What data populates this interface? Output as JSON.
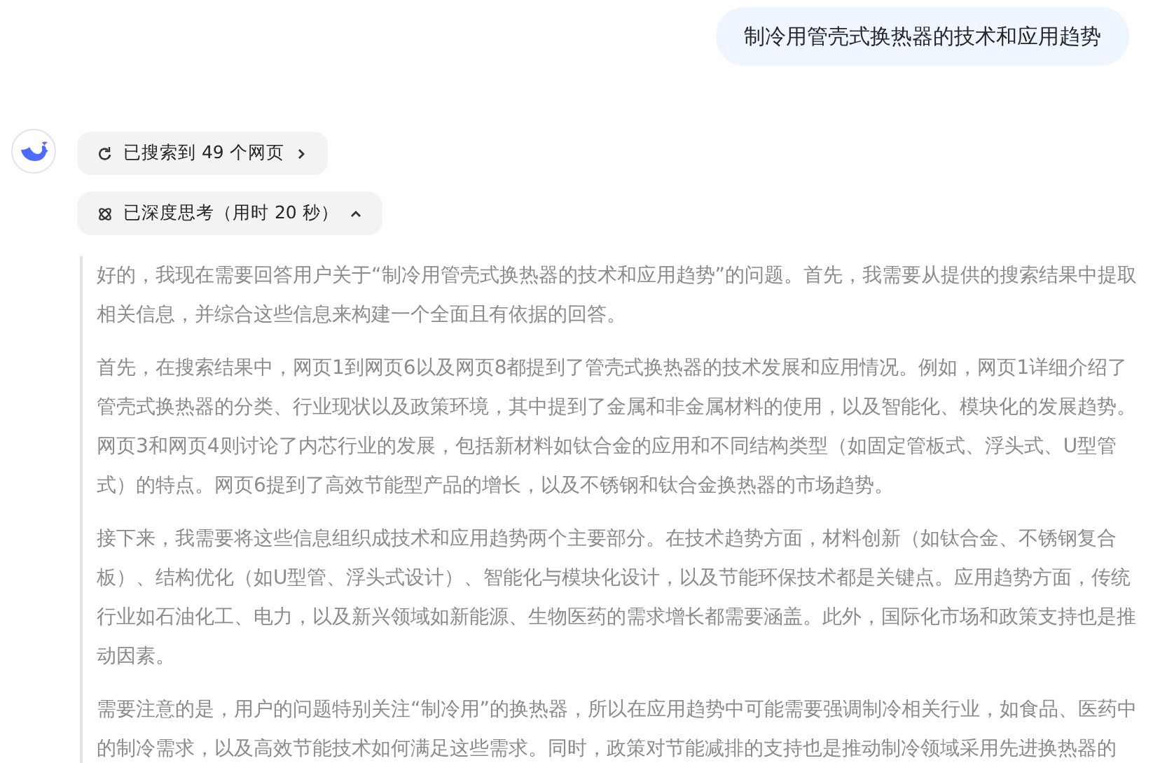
{
  "user_message": "制冷用管壳式换热器的技术和应用趋势",
  "search_status": {
    "label": "已搜索到 49 个网页",
    "expanded": false
  },
  "thinking_status": {
    "label": "已深度思考（用时 20 秒）",
    "expanded": true
  },
  "thought_paragraphs": [
    "好的，我现在需要回答用户关于“制冷用管壳式换热器的技术和应用趋势”的问题。首先，我需要从提供的搜索结果中提取相关信息，并综合这些信息来构建一个全面且有依据的回答。",
    "首先，在搜索结果中，网页1到网页6以及网页8都提到了管壳式换热器的技术发展和应用情况。例如，网页1详细介绍了管壳式换热器的分类、行业现状以及政策环境，其中提到了金属和非金属材料的使用，以及智能化、模块化的发展趋势。网页3和网页4则讨论了内芯行业的发展，包括新材料如钛合金的应用和不同结构类型（如固定管板式、浮头式、U型管式）的特点。网页6提到了高效节能型产品的增长，以及不锈钢和钛合金换热器的市场趋势。",
    "接下来，我需要将这些信息组织成技术和应用趋势两个主要部分。在技术趋势方面，材料创新（如钛合金、不锈钢复合板）、结构优化（如U型管、浮头式设计）、智能化与模块化设计，以及节能环保技术都是关键点。应用趋势方面，传统行业如石油化工、电力，以及新兴领域如新能源、生物医药的需求增长都需要涵盖。此外，国际化市场和政策支持也是推动因素。",
    "需要注意的是，用户的问题特别关注“制冷用”的换热器，所以在应用趋势中可能需要强调制冷相关行业，如食品、医药中的制冷需求，以及高效节能技术如何满足这些需求。同时，政策对节能减排的支持也是推动制冷领域采用先进换热器的"
  ]
}
